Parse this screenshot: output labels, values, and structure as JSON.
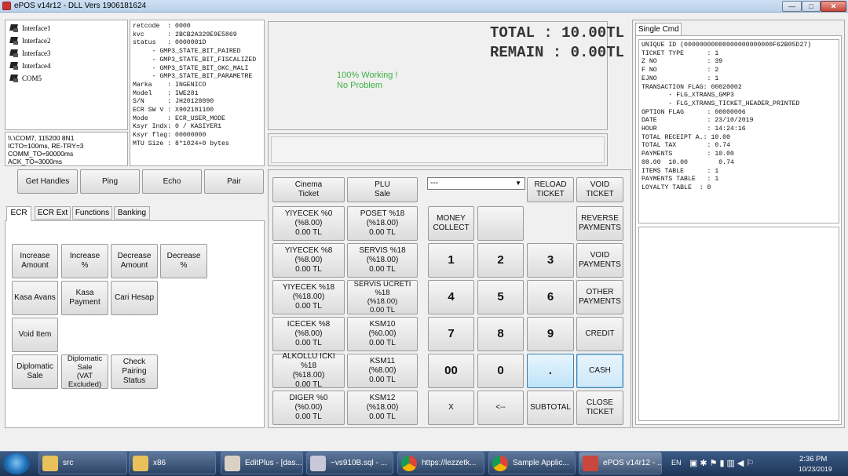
{
  "window": {
    "title": "ePOS v14r12 - DLL Vers 1906181624",
    "min": "—",
    "max": "□",
    "close": "✕"
  },
  "interfaces": [
    "Interface1",
    "Interface2",
    "Interface3",
    "Interface4",
    "COM5"
  ],
  "conn_info": "\\\\.\\COM7, 115200 8N1\nICTO=100ms, RE-TRY=3\nCOMM_TO=90000ms\nACK_TO=3000ms",
  "status_info": "retcode  : 0000\nkvc      : 2BCB2A329E9E5869\nstatus   : 0000001D\n     - GMP3_STATE_BIT_PAIRED\n     - GMP3_STATE_BIT_FISCALIZED\n     - GMP3_STATE_BIT_OKC_MALI\n     - GMP3_STATE_BIT_PARAMETRE\nMarka    : INGENICO\nModel    : IWE281\nS/N      : JH20128890\nECR SW V : X902181100\nMode     : ECR_USER_MODE\nKsyr Indx: 0 / KASIYER1\nKsyr flag: 00000000\nMTU Size : 8*1024+0 bytes",
  "totals": {
    "total": "TOTAL  :  10.00TL",
    "remain": "REMAIN  :  0.00TL"
  },
  "working": {
    "line1": "100% Working !",
    "line2": "No Problem"
  },
  "handle_buttons": {
    "get_handles": "Get Handles",
    "ping": "Ping",
    "echo": "Echo",
    "pair": "Pair"
  },
  "tabs": [
    "ECR",
    "ECR Ext",
    "Functions",
    "Banking"
  ],
  "ecr_buttons": {
    "increase_amount": "Increase\nAmount",
    "increase_pct": "Increase\n%",
    "decrease_amount": "Decrease\nAmount",
    "decrease_pct": "Decrease\n%",
    "kasa_avans": "Kasa Avans",
    "kasa_payment": "Kasa\nPayment",
    "cari_hesap": "Cari Hesap",
    "void_item": "Void Item",
    "diplomatic_sale": "Diplomatic\nSale",
    "diplomatic_sale_vat": "Diplomatic\nSale\n(VAT\nExcluded)",
    "check_pairing": "Check\nPairing\nStatus"
  },
  "plu": {
    "cinema": "Cinema\nTicket",
    "plu_sale": "PLU\nSale",
    "col1": [
      "YIYECEK %0\n(%8.00)\n0.00 TL",
      "YIYECEK %8\n(%8.00)\n0.00 TL",
      "YIYECEK %18\n(%18.00)\n0.00 TL",
      "ICECEK %8\n(%8.00)\n0.00 TL",
      "ALKOLLU ICKI %18\n(%18.00)\n0.00 TL",
      "DIGER %0\n(%0.00)\n0.00 TL"
    ],
    "col2": [
      "POSET %18\n(%18.00)\n0.00 TL",
      "SERVIS %18\n(%18.00)\n0.00 TL",
      "SERVIS UCRETI\n%18\n(%18.00)\n0.00 TL",
      "KSM10\n(%0.00)\n0.00 TL",
      "KSM11\n(%8.00)\n0.00 TL",
      "KSM12\n(%18.00)\n0.00 TL"
    ]
  },
  "keypad": {
    "dropdown": "---",
    "reload": "RELOAD\nTICKET",
    "void_ticket": "VOID\nTICKET",
    "money_collect": "MONEY\nCOLLECT",
    "reverse": "REVERSE\nPAYMENTS",
    "void_payments": "VOID\nPAYMENTS",
    "other_payments": "OTHER\nPAYMENTS",
    "credit": "CREDIT",
    "cash": "CASH",
    "close_ticket": "CLOSE\nTICKET",
    "k1": "1",
    "k2": "2",
    "k3": "3",
    "k4": "4",
    "k5": "5",
    "k6": "6",
    "k7": "7",
    "k8": "8",
    "k9": "9",
    "k00": "00",
    "k0": "0",
    "kdot": ".",
    "x": "X",
    "back": "<--",
    "subtotal": "SUBTOTAL"
  },
  "single_cmd": {
    "title": "Single Cmd",
    "text": "UNIQUE ID (00000000000000000000000F62B05D27)\nTICKET TYPE      : 1\nZ NO             : 39\nF NO             : 2\nEJNO             : 1\nTRANSACTION FLAG: 00020002\n       - FLG_XTRANS_GMP3\n       - FLG_XTRANS_TICKET_HEADER_PRINTED\nOPTION FLAG      : 00000006\nDATE             : 23/10/2019\nHOUR             : 14:24:16\nTOTAL RECEIPT A.: 10.00\nTOTAL TAX        : 0.74\nPAYMENTS         : 10.00\n08.00  10.00        0.74\nITEMS TABLE      : 1\nPAYMENTS TABLE   : 1\nLOYALTY TABLE  : 0"
  },
  "taskbar": {
    "items": [
      "src",
      "x86",
      "EditPlus - [das...",
      "~vs910B.sql - ...",
      "https://lezzetk...",
      "Sample Applic...",
      "ePOS v14r12 - ..."
    ],
    "lang": "EN",
    "time": "2:36 PM",
    "date": "10/23/2019"
  },
  "colors": {
    "status_green": "#3cb043",
    "highlight_blue": "#bfe3f8",
    "taskbar": "#1d3557"
  }
}
